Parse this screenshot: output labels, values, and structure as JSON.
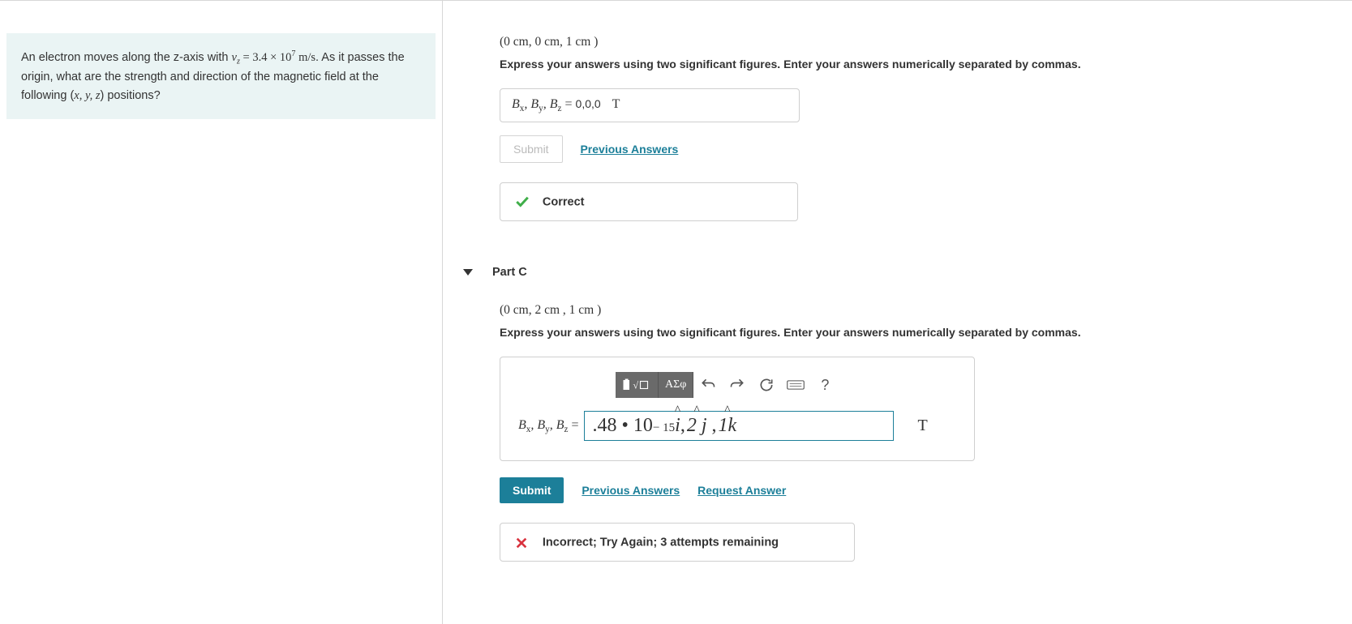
{
  "problem": {
    "line1_pre": "An electron moves along the z-axis with ",
    "vz_var": "v",
    "vz_sub": "z",
    "vz_eq": " = 3.4 × 10",
    "vz_exp": "7",
    "vz_units": " m/s",
    "line1_post": ". As it passes the origin, what are the strength and direction of the magnetic field at the following (",
    "coords": "x, y, z",
    "line1_end": ") positions?"
  },
  "partB": {
    "position": "(0 cm, 0 cm, 1 cm )",
    "instruction": "Express your answers using two significant figures. Enter your answers numerically separated by commas.",
    "label_B": "B",
    "label_x": "x",
    "label_y": "y",
    "label_z": "z",
    "eq": " = ",
    "value": "0,0,0",
    "unit": "T",
    "submit": "Submit",
    "previous": "Previous Answers",
    "feedback": "Correct"
  },
  "partC": {
    "header": "Part C",
    "position": "(0 cm, 2 cm , 1 cm )",
    "instruction": "Express your answers using two significant figures. Enter your answers numerically separated by commas.",
    "toolbar": {
      "greek": "ΑΣφ",
      "help": "?"
    },
    "label_B": "B",
    "label_x": "x",
    "label_y": "y",
    "label_z": "z",
    "eq": " = ",
    "input_value_leading": ".48 • 10",
    "input_value_exp": "− 15",
    "vec_i": "i",
    "comma": ",",
    "vec_2j": "2 j",
    "vec_1k": "1k",
    "unit": "T",
    "submit": "Submit",
    "previous": "Previous Answers",
    "request": "Request Answer",
    "feedback": "Incorrect; Try Again; 3 attempts remaining"
  }
}
